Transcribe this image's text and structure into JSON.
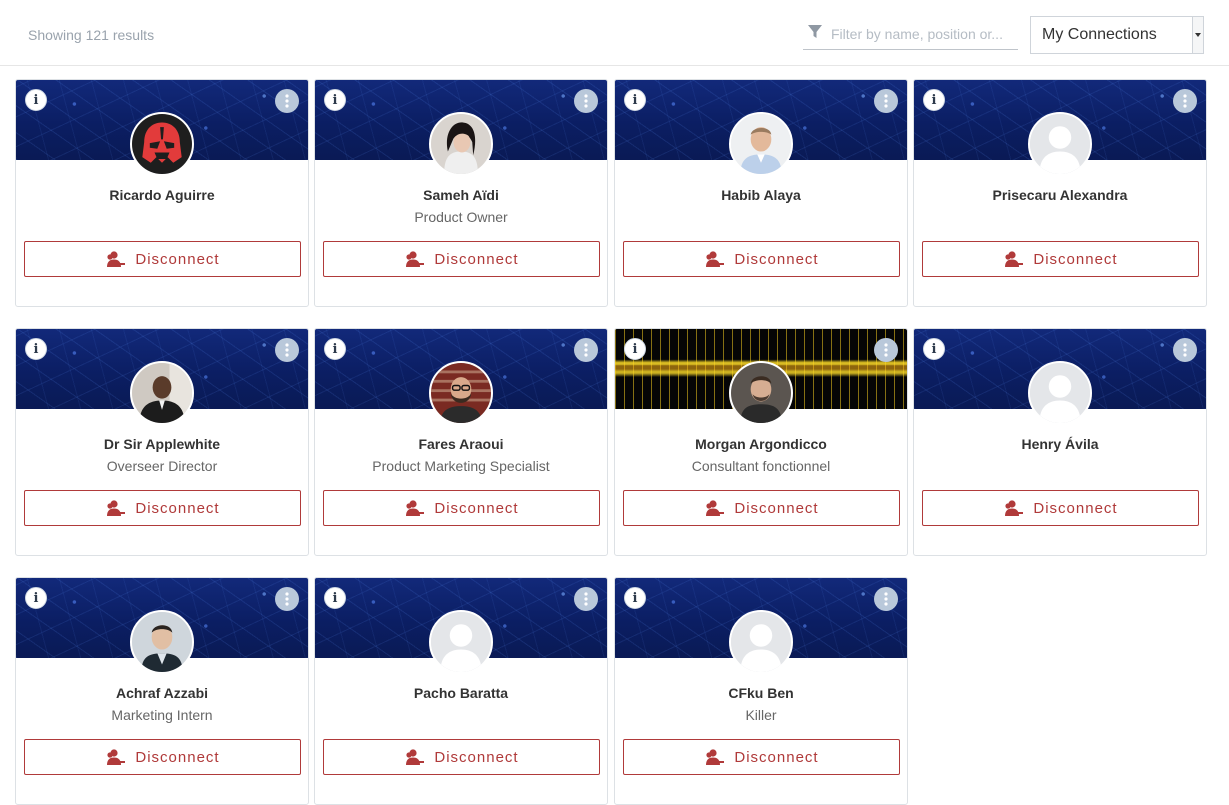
{
  "header": {
    "results_text": "Showing 121 results",
    "filter_placeholder": "Filter by name, position or...",
    "filter_icon": "filter-icon",
    "scope_select_value": "My Connections"
  },
  "colors": {
    "accent_red": "#b03a3a",
    "banner_blue": "#0b1e63"
  },
  "card_common": {
    "disconnect_label": "Disconnect",
    "disconnect_icon": "user-minus-icon",
    "info_icon": "info-icon",
    "more_icon": "vertical-ellipsis-icon"
  },
  "cards": [
    {
      "name": "Ricardo Aguirre",
      "position": "",
      "avatar": "darth-vader-mask"
    },
    {
      "name": "Sameh Aïdi",
      "position": "Product Owner",
      "avatar": "photo"
    },
    {
      "name": "Habib Alaya",
      "position": "",
      "avatar": "photo"
    },
    {
      "name": "Prisecaru Alexandra",
      "position": "",
      "avatar": "default-user"
    },
    {
      "name": "Dr Sir Applewhite",
      "position": "Overseer Director",
      "avatar": "photo"
    },
    {
      "name": "Fares Araoui",
      "position": "Product Marketing Specialist",
      "avatar": "photo"
    },
    {
      "name": "Morgan Argondicco",
      "position": "Consultant fonctionnel",
      "avatar": "photo"
    },
    {
      "name": "Henry Ávila",
      "position": "",
      "avatar": "default-user"
    },
    {
      "name": "Achraf Azzabi",
      "position": "Marketing Intern",
      "avatar": "photo"
    },
    {
      "name": "Pacho Baratta",
      "position": "",
      "avatar": "default-user"
    },
    {
      "name": "CFku Ben",
      "position": "Killer",
      "avatar": "default-user"
    }
  ]
}
